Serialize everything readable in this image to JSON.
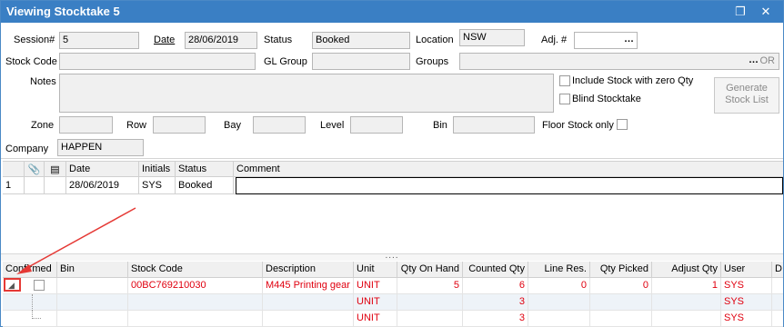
{
  "window": {
    "title": "Viewing Stocktake 5"
  },
  "form": {
    "session_label": "Session#",
    "session_value": "5",
    "date_label": "Date",
    "date_value": "28/06/2019",
    "status_label": "Status",
    "status_value": "Booked",
    "location_label": "Location",
    "location_value": "NSW",
    "adj_label": "Adj. #",
    "adj_value": "",
    "stock_code_label": "Stock Code",
    "stock_code_value": "",
    "gl_group_label": "GL Group",
    "gl_group_value": "",
    "groups_label": "Groups",
    "groups_value": "",
    "groups_or": "OR",
    "notes_label": "Notes",
    "notes_value": "",
    "include_zero_label": "Include Stock with zero Qty",
    "blind_label": "Blind Stocktake",
    "generate_label": "Generate Stock List",
    "zone_label": "Zone",
    "row_label": "Row",
    "bay_label": "Bay",
    "level_label": "Level",
    "bin_label": "Bin",
    "floor_label": "Floor Stock only",
    "company_label": "Company",
    "company_value": "HAPPEN"
  },
  "upper_grid": {
    "columns": [
      "",
      "",
      "",
      "Date",
      "Initials",
      "Status",
      "Comment"
    ],
    "rows": [
      {
        "num": "1",
        "date": "28/06/2019",
        "initials": "SYS",
        "status": "Booked",
        "comment": ""
      }
    ]
  },
  "splitter": "....",
  "lower_grid": {
    "columns": [
      "Confirmed",
      "Bin",
      "Stock Code",
      "Description",
      "Unit",
      "Qty On Hand",
      "Counted Qty",
      "Line Res.",
      "Qty Picked",
      "Adjust Qty",
      "User",
      "D"
    ],
    "rows": [
      {
        "bin": "",
        "stock_code": "00BC769210030",
        "description": "M445 Printing gear",
        "unit": "UNIT",
        "qty_on_hand": "5",
        "counted_qty": "6",
        "line_res": "0",
        "qty_picked": "0",
        "adjust_qty": "1",
        "user": "SYS"
      },
      {
        "bin": "",
        "stock_code": "",
        "description": "",
        "unit": "UNIT",
        "qty_on_hand": "",
        "counted_qty": "3",
        "line_res": "",
        "qty_picked": "",
        "adjust_qty": "",
        "user": "SYS"
      },
      {
        "bin": "",
        "stock_code": "",
        "description": "",
        "unit": "UNIT",
        "qty_on_hand": "",
        "counted_qty": "3",
        "line_res": "",
        "qty_picked": "",
        "adjust_qty": "",
        "user": "SYS"
      }
    ]
  },
  "colors": {
    "titlebar": "#3a7fc4",
    "row_text": "#e0000f",
    "annotation": "#e53935"
  }
}
